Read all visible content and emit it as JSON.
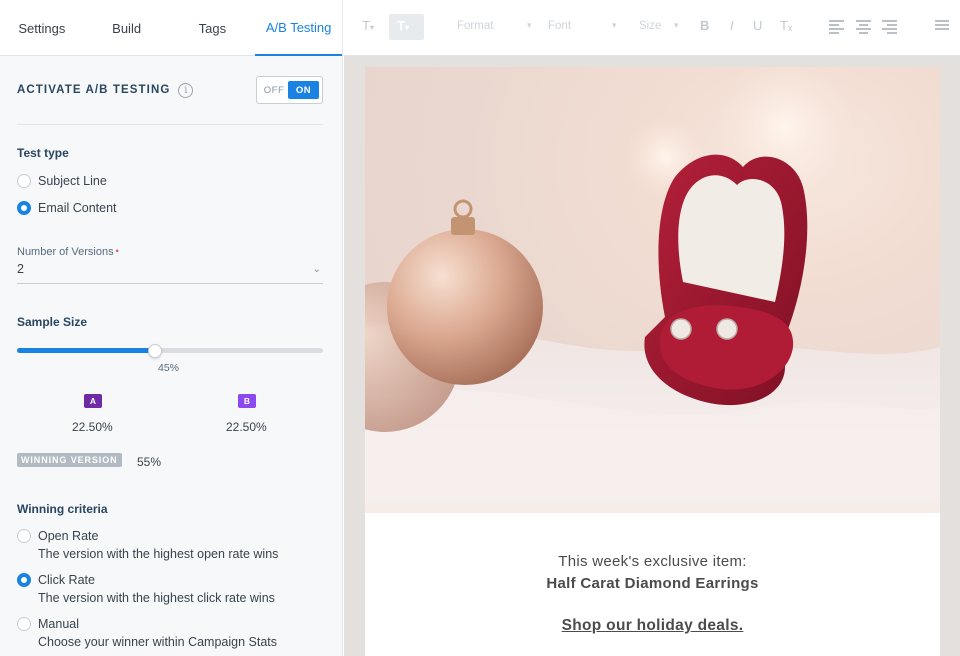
{
  "tabs": [
    "Settings",
    "Build",
    "Tags",
    "A/B Testing"
  ],
  "activate": {
    "label": "ACTIVATE A/B TESTING",
    "info_glyph": "i",
    "toggle_off": "OFF",
    "toggle_on": "ON"
  },
  "test_type": {
    "title": "Test type",
    "options": [
      {
        "label": "Subject Line",
        "selected": false
      },
      {
        "label": "Email Content",
        "selected": true
      }
    ]
  },
  "versions": {
    "label": "Number of Versions",
    "required_mark": "•",
    "value": "2",
    "chevron": "⌄"
  },
  "sample": {
    "title": "Sample Size",
    "percent": 45,
    "percent_label": "45%"
  },
  "version_split": [
    {
      "badge": "A",
      "value": "22.50%",
      "color": "#6f2ba6"
    },
    {
      "badge": "B",
      "value": "22.50%",
      "color": "#8a4af0"
    }
  ],
  "winning_version": {
    "label": "WINNING VERSION",
    "value": "55%"
  },
  "criteria": {
    "title": "Winning criteria",
    "options": [
      {
        "label": "Open Rate",
        "desc": "The version with the highest open rate wins",
        "selected": false
      },
      {
        "label": "Click Rate",
        "desc": "The version with the highest click rate wins",
        "selected": true
      },
      {
        "label": "Manual",
        "desc": "Choose your winner within Campaign Stats",
        "selected": false
      }
    ]
  },
  "toolbar": {
    "text_color": "T",
    "bg_color": "T",
    "format": "Format",
    "font": "Font",
    "size": "Size",
    "bold": "B",
    "italic": "I",
    "underline": "U",
    "clear": "Tₓ",
    "caret": "▾"
  },
  "email": {
    "line1": "This week's exclusive item:",
    "line2": "Half Carat Diamond Earrings",
    "cta": "Shop our holiday deals."
  },
  "colors": {
    "accent": "#1a82e2",
    "ring_box": "#9e1b33"
  }
}
